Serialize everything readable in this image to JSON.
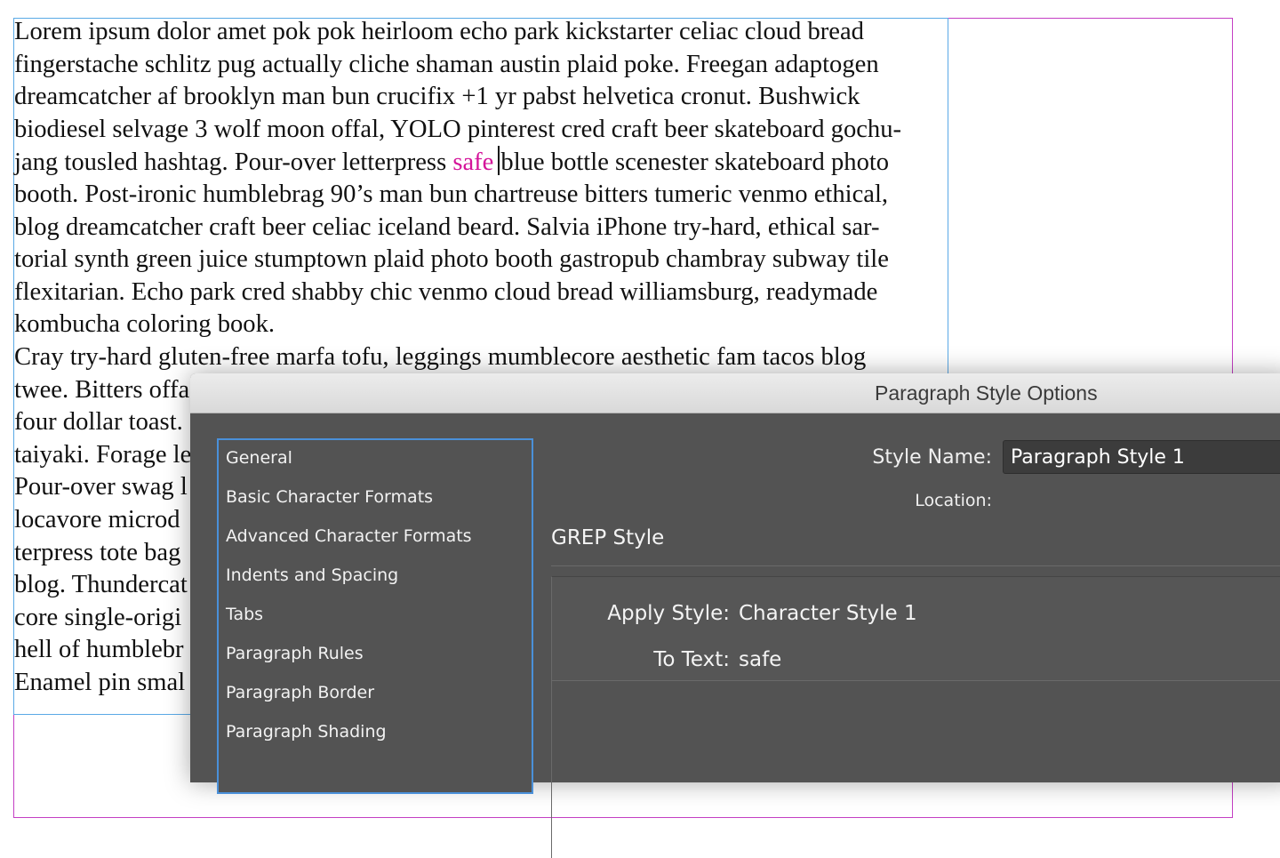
{
  "document": {
    "lines": [
      "Lorem ipsum dolor amet pok pok heirloom echo park kickstarter celiac cloud bread",
      "fingerstache schlitz pug actually cliche shaman austin plaid poke. Freegan adaptogen",
      "dreamcatcher af brooklyn man bun crucifix +1 yr pabst helvetica cronut. Bushwick",
      "biodiesel selvage 3 wolf moon offal, YOLO pinterest cred craft beer skateboard gochu-",
      "booth. Post-ironic humblebrag 90’s man bun chartreuse bitters tumeric venmo ethical,",
      "blog dreamcatcher craft beer celiac iceland beard. Salvia iPhone try-hard, ethical sar-",
      "torial synth green juice stumptown plaid photo booth gastropub chambray subway tile",
      "flexitarian. Echo park cred shabby chic venmo cloud bread williamsburg, readymade",
      "kombucha coloring book.",
      "Cray try-hard gluten-free marfa tofu, leggings mumblecore aesthetic fam tacos blog",
      "twee. Bitters offa",
      "four dollar toast.",
      "taiyaki. Forage le",
      "Pour-over swag l",
      "locavore microd",
      "terpress tote bag",
      "blog. Thundercat",
      "core single-origi",
      "hell of humblebr",
      "Enamel pin smal"
    ],
    "grep_line": {
      "before": "jang tousled hashtag. Pour-over letterpress ",
      "match": "safe",
      "after": "blue bottle scenester skateboard photo"
    }
  },
  "dialog": {
    "title": "Paragraph Style Options",
    "categories": [
      "General",
      "Basic Character Formats",
      "Advanced Character Formats",
      "Indents and Spacing",
      "Tabs",
      "Paragraph Rules",
      "Paragraph Border",
      "Paragraph Shading"
    ],
    "style_name_label": "Style Name:",
    "style_name_value": "Paragraph Style 1",
    "location_label": "Location:",
    "section_title": "GREP Style",
    "apply_style_label": "Apply Style:",
    "apply_style_value": "Character Style 1",
    "to_text_label": "To Text:",
    "to_text_value": "safe"
  }
}
